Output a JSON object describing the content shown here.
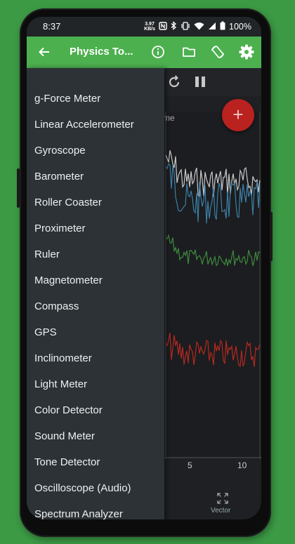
{
  "status_bar": {
    "time": "8:37",
    "data_speed_value": "3.97",
    "data_speed_unit": "KB/s",
    "battery": "100%",
    "icons": [
      "nfc-icon",
      "bluetooth-icon",
      "vibrate-icon",
      "wifi-icon",
      "signal-icon",
      "battery-icon"
    ]
  },
  "app_bar": {
    "title": "Physics To...",
    "icons": [
      "back-arrow-icon",
      "info-icon",
      "folder-icon",
      "rotate-screen-icon",
      "settings-gear-icon"
    ]
  },
  "drawer": {
    "items": [
      {
        "label": "g-Force Meter"
      },
      {
        "label": "Linear Accelerometer"
      },
      {
        "label": "Gyroscope"
      },
      {
        "label": "Barometer"
      },
      {
        "label": "Roller Coaster"
      },
      {
        "label": "Proximeter"
      },
      {
        "label": "Ruler"
      },
      {
        "label": "Magnetometer"
      },
      {
        "label": "Compass"
      },
      {
        "label": "GPS"
      },
      {
        "label": "Inclinometer"
      },
      {
        "label": "Light Meter"
      },
      {
        "label": "Color Detector"
      },
      {
        "label": "Sound Meter"
      },
      {
        "label": "Tone Detector"
      },
      {
        "label": "Oscilloscope (Audio)"
      },
      {
        "label": "Spectrum Analyzer (Audio)"
      }
    ]
  },
  "background": {
    "toolbar_icons": [
      "reset-icon",
      "pause-icon"
    ],
    "fab_label": "+",
    "chart_partial_label": "me",
    "x_ticks": [
      "5",
      "10"
    ],
    "bottom_tab_label": "Vector",
    "bottom_tab_icon": "expand-arrows-icon"
  },
  "colors": {
    "app_bar": "#4cb04f",
    "drawer": "#2c3236",
    "fab": "#b9221f",
    "trace_white": "#c9c9c9",
    "trace_blue": "#3d7fa6",
    "trace_green": "#3f8a3e",
    "trace_red": "#b5291f"
  }
}
